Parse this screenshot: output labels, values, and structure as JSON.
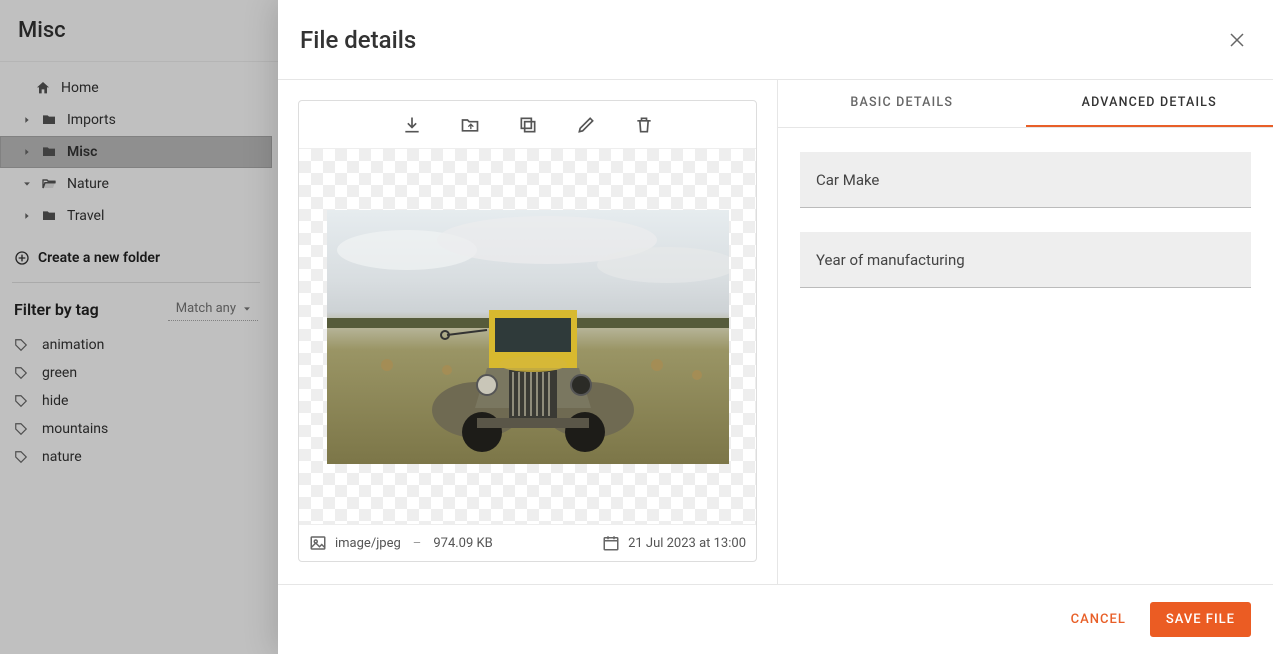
{
  "page": {
    "title": "Misc"
  },
  "sidebar": {
    "home": {
      "label": "Home"
    },
    "folders": [
      {
        "label": "Imports",
        "expanded": false,
        "selected": false
      },
      {
        "label": "Misc",
        "expanded": false,
        "selected": true
      },
      {
        "label": "Nature",
        "expanded": true,
        "selected": false
      },
      {
        "label": "Travel",
        "expanded": false,
        "selected": false
      }
    ],
    "create_label": "Create a new folder",
    "filter_title": "Filter by tag",
    "match_selected": "Match any",
    "tags": [
      {
        "label": "animation"
      },
      {
        "label": "green"
      },
      {
        "label": "hide"
      },
      {
        "label": "mountains"
      },
      {
        "label": "nature"
      }
    ]
  },
  "modal": {
    "title": "File details",
    "tabs": {
      "basic": "BASIC DETAILS",
      "advanced": "ADVANCED DETAILS",
      "active": "advanced"
    },
    "fields": [
      {
        "label": "Car Make"
      },
      {
        "label": "Year of manufacturing"
      }
    ],
    "meta": {
      "mime": "image/jpeg",
      "size": "974.09 KB",
      "date": "21 Jul 2023 at 13:00"
    },
    "buttons": {
      "cancel": "CANCEL",
      "save": "SAVE FILE"
    }
  }
}
